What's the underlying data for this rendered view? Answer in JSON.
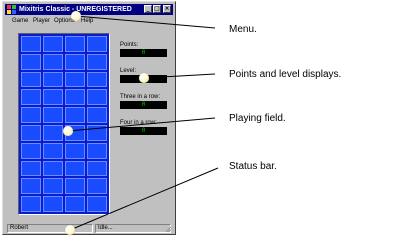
{
  "window": {
    "title": "Mixitris Classic - UNREGISTERED",
    "buttons": {
      "minimize": "_",
      "maximize": "□",
      "close": "×"
    }
  },
  "menu": {
    "items": [
      "Game",
      "Player",
      "Options",
      "Help"
    ]
  },
  "stats": {
    "points_label": "Points:",
    "points_value": "0",
    "level_label": "Level:",
    "level_value": "1",
    "three_label": "Three in a row:",
    "three_value": "0",
    "four_label": "Four in a row:",
    "four_value": "0"
  },
  "status": {
    "player": "Robert",
    "state": "Idle..."
  },
  "callouts": {
    "menu": "Menu.",
    "points": "Points and level displays.",
    "field": "Playing field.",
    "status": "Status bar."
  },
  "colors": {
    "titlebar": "#000080",
    "field_background": "#0a1bd6",
    "cell": "#1a4cff",
    "display_background": "#000000",
    "display_digits": "#00c000"
  },
  "playing_field": {
    "columns": 4,
    "rows": 10
  }
}
